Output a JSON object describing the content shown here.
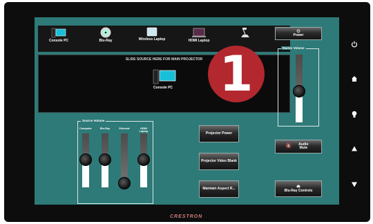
{
  "sources": [
    {
      "label": "Console PC",
      "icon": "console-pc-icon"
    },
    {
      "label": "Blu-Ray",
      "icon": "disc-icon"
    },
    {
      "label": "Wireless Laptop",
      "icon": "wireless-laptop-icon"
    },
    {
      "label": "HDMI Laptop",
      "icon": "hdmi-laptop-icon"
    },
    {
      "label": "",
      "icon": "document-camera-icon"
    }
  ],
  "dropzone": {
    "hint": "SLIDE SOURCE HERE FOR MAIN PROJECTOR",
    "current": "Console PC"
  },
  "source_volume": {
    "title": "Source Volume",
    "channels": [
      {
        "label": "Computer",
        "level": 0.55
      },
      {
        "label": "Blu-Ray",
        "level": 0.55
      },
      {
        "label": "External",
        "level": 0.1
      },
      {
        "label": "HDMI Laptop",
        "level": 0.55
      }
    ]
  },
  "master_volume": {
    "title": "Master Volume",
    "level": 0.47
  },
  "buttons": {
    "power": "Power",
    "projector_power": "Projector Power",
    "projector_video_blank": "Projector Video Blank",
    "maintain_aspect": "Maintain Aspect R...",
    "audio_mute": "Audio Mute",
    "bluray_controls": "Blu-Ray Controls"
  },
  "badge": "1",
  "brand": "CRESTRON",
  "side_buttons": [
    "power-icon",
    "home-icon",
    "light-icon",
    "up-arrow-icon",
    "down-arrow-icon"
  ],
  "colors": {
    "screen": "#2e7a78",
    "badge": "#b3282e"
  }
}
